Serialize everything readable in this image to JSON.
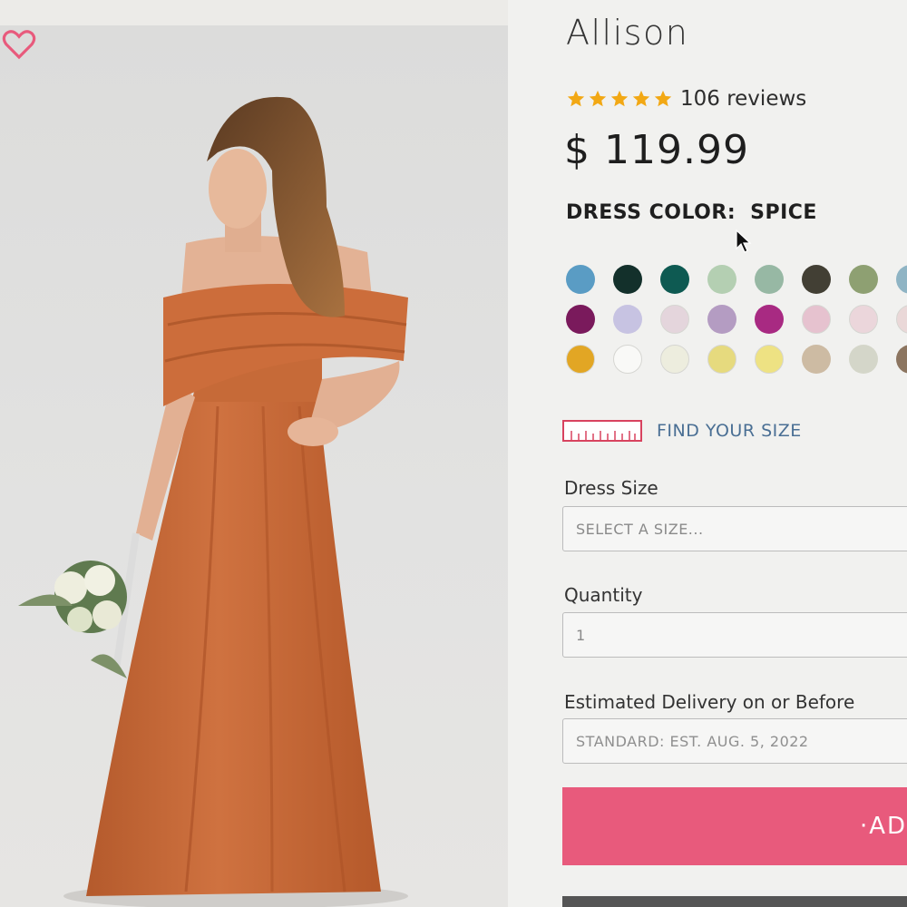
{
  "product": {
    "title": "Allison",
    "reviews_label": "106 reviews",
    "rating_stars": 5,
    "price": "$ 119.99"
  },
  "colors": {
    "label": "DRESS COLOR:",
    "selected": "SPICE",
    "accent_star": "#f2a814",
    "accent_pink": "#e85a7c",
    "swatches": [
      [
        "#5a9cc4",
        "#13302b",
        "#0e5a52",
        "#b4cfb2",
        "#97b8a4",
        "#423f34",
        "#8ea072",
        "#8fb4c4"
      ],
      [
        "#7a1a5c",
        "#c7c3e2",
        "#e4d5dc",
        "#b49cc2",
        "#a82a82",
        "#e6c2cf",
        "#ebd6db",
        "#ead8d8"
      ],
      [
        "#e2a624",
        "#f9f9f7",
        "#ededde",
        "#e6da7e",
        "#eee283",
        "#cdbba3",
        "#d4d6c9",
        "#8c7560"
      ]
    ]
  },
  "size_guide": {
    "label": "FIND YOUR SIZE"
  },
  "form": {
    "dress_size_label": "Dress Size",
    "dress_size_placeholder": "SELECT A SIZE...",
    "quantity_label": "Quantity",
    "quantity_value": "1",
    "delivery_label": "Estimated Delivery on or Before",
    "delivery_value": "STANDARD: EST. AUG. 5, 2022"
  },
  "actions": {
    "add_label": "·AD"
  }
}
